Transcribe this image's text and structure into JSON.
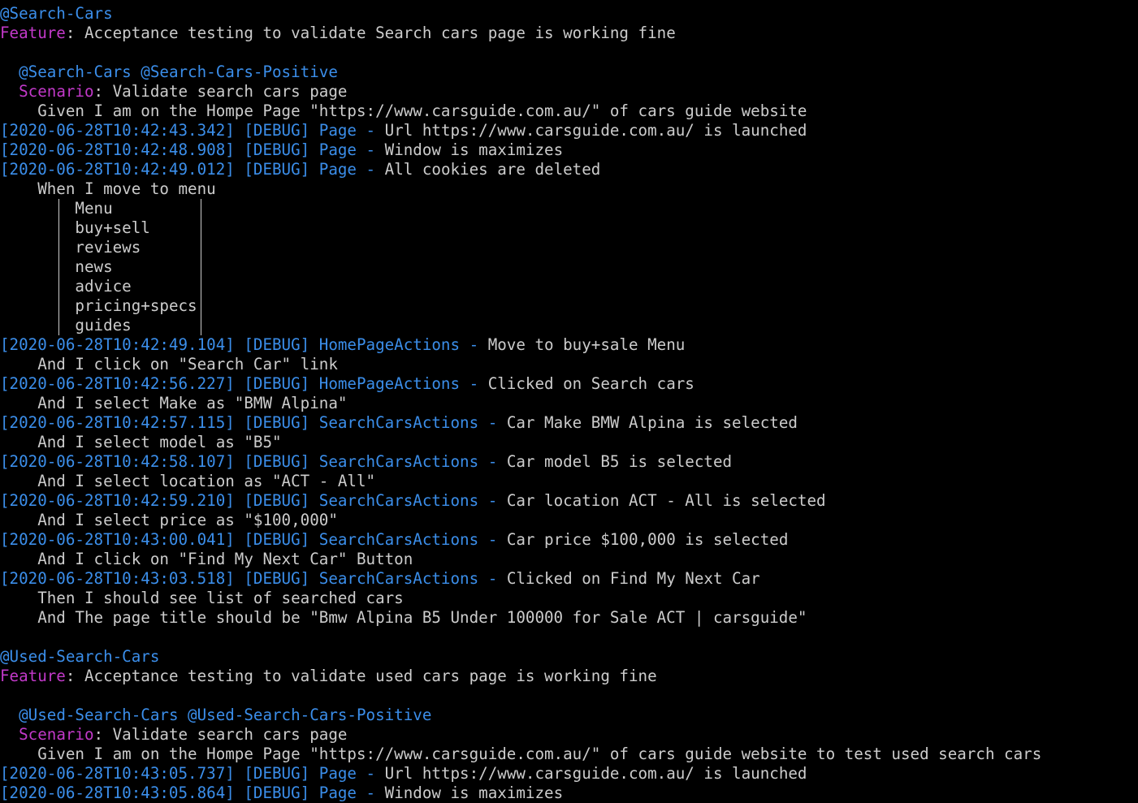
{
  "colors": {
    "background": "#000000",
    "text": "#cccccc",
    "tag": "#3b8eea",
    "keyword": "#c239c9"
  },
  "lines": [
    {
      "kind": "tag",
      "text": "@Search-Cars"
    },
    {
      "kind": "feature",
      "kw": "Feature",
      "text": ": Acceptance testing to validate Search cars page is working fine"
    },
    {
      "kind": "blank",
      "text": ""
    },
    {
      "kind": "tag",
      "indent": "  ",
      "text": "@Search-Cars @Search-Cars-Positive"
    },
    {
      "kind": "feature",
      "indent": "  ",
      "kw": "Scenario",
      "text": ": Validate search cars page"
    },
    {
      "kind": "step",
      "text": "    Given I am on the Hompe Page \"https://www.carsguide.com.au/\" of cars guide website"
    },
    {
      "kind": "log",
      "ts": "[2020-06-28T10:42:43.342] [DEBUG] Page - ",
      "text": "Url https://www.carsguide.com.au/ is launched"
    },
    {
      "kind": "log",
      "ts": "[2020-06-28T10:42:48.908] [DEBUG] Page - ",
      "text": "Window is maximizes"
    },
    {
      "kind": "log",
      "ts": "[2020-06-28T10:42:49.012] [DEBUG] Page - ",
      "text": "All cookies are deleted"
    },
    {
      "kind": "step",
      "text": "    When I move to menu"
    }
  ],
  "menu_table": [
    "Menu",
    "buy+sell",
    "reviews",
    "news",
    "advice",
    "pricing+specs",
    "guides"
  ],
  "lines2": [
    {
      "kind": "log",
      "ts": "[2020-06-28T10:42:49.104] [DEBUG] HomePageActions - ",
      "text": "Move to buy+sale Menu"
    },
    {
      "kind": "step",
      "text": "    And I click on \"Search Car\" link"
    },
    {
      "kind": "log",
      "ts": "[2020-06-28T10:42:56.227] [DEBUG] HomePageActions - ",
      "text": "Clicked on Search cars"
    },
    {
      "kind": "step",
      "text": "    And I select Make as \"BMW Alpina\""
    },
    {
      "kind": "log",
      "ts": "[2020-06-28T10:42:57.115] [DEBUG] SearchCarsActions - ",
      "text": "Car Make BMW Alpina is selected"
    },
    {
      "kind": "step",
      "text": "    And I select model as \"B5\""
    },
    {
      "kind": "log",
      "ts": "[2020-06-28T10:42:58.107] [DEBUG] SearchCarsActions - ",
      "text": "Car model B5 is selected"
    },
    {
      "kind": "step",
      "text": "    And I select location as \"ACT - All\""
    },
    {
      "kind": "log",
      "ts": "[2020-06-28T10:42:59.210] [DEBUG] SearchCarsActions - ",
      "text": "Car location ACT - All is selected"
    },
    {
      "kind": "step",
      "text": "    And I select price as \"$100,000\""
    },
    {
      "kind": "log",
      "ts": "[2020-06-28T10:43:00.041] [DEBUG] SearchCarsActions - ",
      "text": "Car price $100,000 is selected"
    },
    {
      "kind": "step",
      "text": "    And I click on \"Find My Next Car\" Button"
    },
    {
      "kind": "log",
      "ts": "[2020-06-28T10:43:03.518] [DEBUG] SearchCarsActions - ",
      "text": "Clicked on Find My Next Car"
    },
    {
      "kind": "step",
      "text": "    Then I should see list of searched cars"
    },
    {
      "kind": "step",
      "text": "    And The page title should be \"Bmw Alpina B5 Under 100000 for Sale ACT | carsguide\""
    },
    {
      "kind": "blank",
      "text": ""
    },
    {
      "kind": "tag",
      "text": "@Used-Search-Cars"
    },
    {
      "kind": "feature",
      "kw": "Feature",
      "text": ": Acceptance testing to validate used cars page is working fine"
    },
    {
      "kind": "blank",
      "text": ""
    },
    {
      "kind": "tag",
      "indent": "  ",
      "text": "@Used-Search-Cars @Used-Search-Cars-Positive"
    },
    {
      "kind": "feature",
      "indent": "  ",
      "kw": "Scenario",
      "text": ": Validate search cars page"
    },
    {
      "kind": "step",
      "text": "    Given I am on the Hompe Page \"https://www.carsguide.com.au/\" of cars guide website to test used search cars"
    },
    {
      "kind": "log",
      "ts": "[2020-06-28T10:43:05.737] [DEBUG] Page - ",
      "text": "Url https://www.carsguide.com.au/ is launched"
    },
    {
      "kind": "log",
      "ts": "[2020-06-28T10:43:05.864] [DEBUG] Page - ",
      "text": "Window is maximizes"
    }
  ]
}
